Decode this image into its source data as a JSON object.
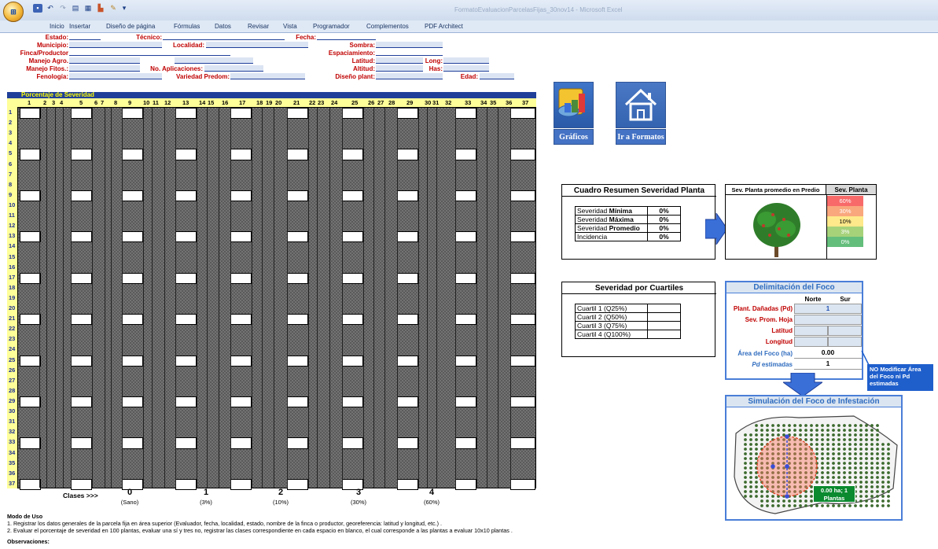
{
  "window": {
    "title": "FormatoEvaluacionParcelasFijas_30nov14 - Microsoft Excel",
    "office_button_icon": "office-logo-icon",
    "quick_access": [
      "save-icon",
      "undo-icon",
      "redo-icon",
      "form-icon",
      "table-icon",
      "chart-icon",
      "edit-icon",
      "dropdown-icon"
    ]
  },
  "ribbon": {
    "tabs": [
      "Inicio",
      "Insertar",
      "Diseño de página",
      "Fórmulas",
      "Datos",
      "Revisar",
      "Vista",
      "Programador",
      "Complementos",
      "PDF Architect"
    ]
  },
  "header_fields": {
    "estado": "Estado:",
    "tecnico": "Técnico:",
    "fecha": "Fecha:",
    "municipio": "Municipio:",
    "localidad": "Localidad:",
    "sombra": "Sombra:",
    "finca": "Finca/Productor",
    "espaciamiento": "Espaciamiento:",
    "manejo_agro": "Manejo Agro.",
    "latitud": "Latitud:",
    "long": "Long:",
    "manejo_fitos": "Manejo Fitos.:",
    "no_aplicaciones": "No. Aplicaciones:",
    "altitud": "Altitud:",
    "has": "Has:",
    "fenologia": "Fenología:",
    "variedad": "Variedad Predom:",
    "diseno": "Diseño plant:",
    "edad": "Edad:"
  },
  "severity_grid": {
    "title": "Porcentaje de Severidad",
    "columns": [
      "1",
      "2",
      "3",
      "4",
      "5",
      "6",
      "7",
      "8",
      "9",
      "10",
      "11",
      "12",
      "13",
      "14",
      "15",
      "16",
      "17",
      "18",
      "19",
      "20",
      "21",
      "22",
      "23",
      "24",
      "25",
      "26",
      "27",
      "28",
      "29",
      "30",
      "31",
      "32",
      "33",
      "34",
      "35",
      "36",
      "37"
    ],
    "rows": [
      "1",
      "2",
      "3",
      "4",
      "5",
      "6",
      "7",
      "8",
      "9",
      "10",
      "11",
      "12",
      "13",
      "14",
      "15",
      "16",
      "17",
      "18",
      "19",
      "20",
      "21",
      "22",
      "23",
      "24",
      "25",
      "26",
      "27",
      "28",
      "29",
      "30",
      "31",
      "32",
      "33",
      "34",
      "35",
      "36",
      "37"
    ]
  },
  "classes": {
    "label": "Clases >>>",
    "items": [
      {
        "value": "0",
        "sub": "(Sano)"
      },
      {
        "value": "1",
        "sub": "(3%)"
      },
      {
        "value": "2",
        "sub": "(10%)"
      },
      {
        "value": "3",
        "sub": "(30%)"
      },
      {
        "value": "4",
        "sub": "(60%)"
      }
    ]
  },
  "buttons": {
    "graficos": "Gráficos",
    "graficos_icon": "chart-3d-icon",
    "formatos": "Ir a Formatos",
    "formatos_icon": "home-icon"
  },
  "resumen": {
    "title": "Cuadro Resumen Severidad Planta",
    "rows": [
      {
        "label_pre": "Severidad ",
        "label_bold": "Mínima",
        "value": "0%"
      },
      {
        "label_pre": "Severidad ",
        "label_bold": "Máxima",
        "value": "0%"
      },
      {
        "label_pre": "Severidad ",
        "label_bold": "Promedio",
        "value": "0%"
      },
      {
        "label_pre": "Incidencia",
        "label_bold": "",
        "value": "0%"
      }
    ]
  },
  "sev_planta": {
    "col1": "Sev. Planta promedio en Predio",
    "col2": "Sev. Planta",
    "tree_icon": "coffee-tree-icon",
    "scale": [
      {
        "label": "60%",
        "color": "#f86a6a"
      },
      {
        "label": "30%",
        "color": "#f9a77d"
      },
      {
        "label": "10%",
        "color": "#ffe98a"
      },
      {
        "label": "3%",
        "color": "#a6d27a"
      },
      {
        "label": "0%",
        "color": "#63be7b"
      }
    ]
  },
  "cuartiles": {
    "title": "Severidad por Cuartiles",
    "rows": [
      "Cuartil 1 (Q25%)",
      "Cuartil 2 (Q50%)",
      "Cuartil 3 (Q75%)",
      "Cuartil 4 (Q100%)"
    ]
  },
  "foco": {
    "title": "Delimitación del Foco",
    "norte": "Norte",
    "sur": "Sur",
    "plant_danadas": "Plant. Dañadas (Pd)",
    "plant_danadas_val": "1",
    "sev_prom": "Sev. Prom. Hoja",
    "latitud": "Latitud",
    "longitud": "Longitud",
    "area": "Área del Foco (ha)",
    "area_val": "0.00",
    "pd_est_a": "Pd",
    "pd_est_b": "estimadas",
    "pd_est_val": "1",
    "note": "NO Modificar Área del Foco ni Pd estimadas"
  },
  "simulacion": {
    "title": "Simulación del Foco de Infestación",
    "badge": "0.00 ha; 1 Plantas"
  },
  "footer": {
    "modo_title": "Modo de Uso",
    "line1": "1. Registrar los datos generales de la parcela fija en área superior (Evaluador, fecha, localidad, estado, nombre de la finca o productor, georeferencia: latitud y longitud, etc.) .",
    "line2": "2. Evaluar el porcentaje de severidad en 100 plantas, evaluar una sí y tres no, registrar las clases correspondiente en cada espacio en blanco, el cual corresponde a las plantas a evaluar 10x10 plantas .",
    "obs": "Observaciones:"
  },
  "colors": {
    "header_label": "#c00000",
    "grid_title_bg": "#1f3f99",
    "grid_title_text": "#ffff00",
    "row_header_bg": "#ffff99",
    "button_blue": "#4472c4",
    "foco_blue": "#4a7ed8"
  }
}
